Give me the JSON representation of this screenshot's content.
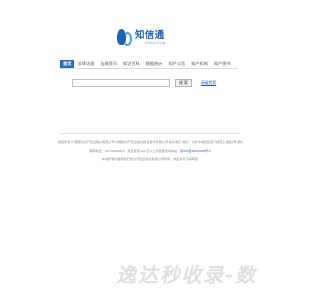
{
  "logo": {
    "cn": "知信通",
    "en": "ZhiXinTong"
  },
  "nav": {
    "items": [
      {
        "label": "首页",
        "active": true
      },
      {
        "label": "法律法规",
        "active": false
      },
      {
        "label": "法规资讯",
        "active": false
      },
      {
        "label": "知识百科",
        "active": false
      },
      {
        "label": "数据统计",
        "active": false
      },
      {
        "label": "知产公告",
        "active": false
      },
      {
        "label": "知产机构",
        "active": false
      },
      {
        "label": "知产图书",
        "active": false
      }
    ]
  },
  "search": {
    "value": "",
    "placeholder": "",
    "button_label": "搜 索",
    "advanced_link": "高级检索"
  },
  "footer": {
    "line1": "版权所有 © 国家知识产权出版社有限公司 中国知识产权出版社信息技术有限公司 联系我们 地址：北京市海淀区蓟门桥西土城路6号 邮编：100088",
    "line2_prefix": "客服电话：010-82000860 · 建议使用 IE8 及以上浏览器访问本站 ·",
    "line2_link": "京ICP备11026438号-2",
    "line3": "本站所有内容版权归知识产权出版社有限公司所有，未经许可不得转载"
  },
  "watermark": {
    "text": "逸达秒收录-数"
  },
  "colors": {
    "brand": "#1f62b5",
    "nav_active": "#2f6ab7",
    "link": "#1f5fb0"
  }
}
